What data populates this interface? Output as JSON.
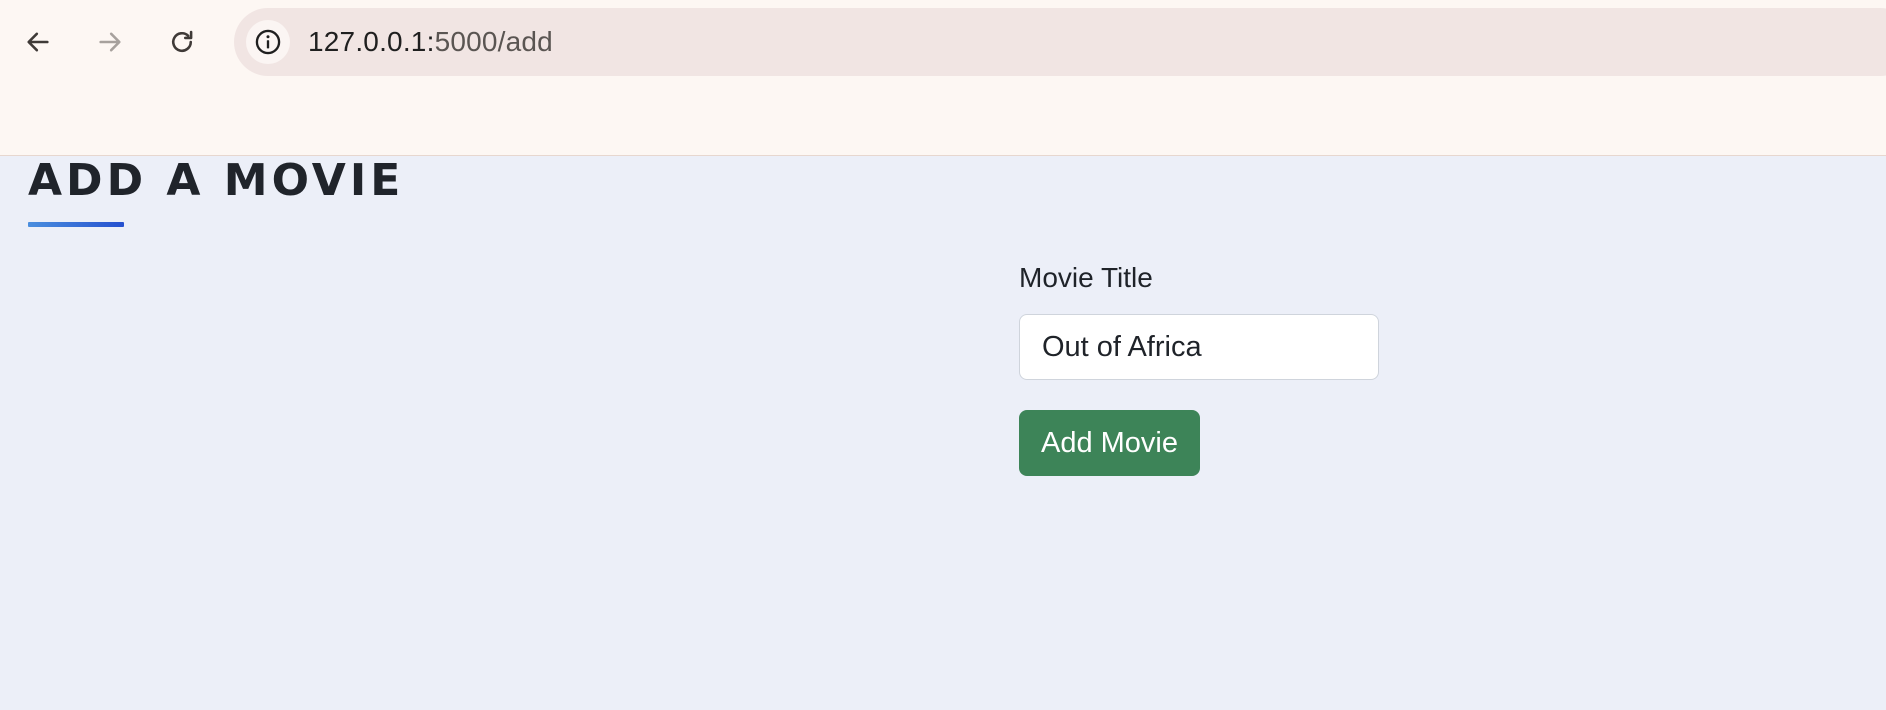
{
  "browser": {
    "url_host": "127.0.0.1:",
    "url_path": "5000/add",
    "icons": {
      "back": "arrow-left-icon",
      "forward": "arrow-right-icon",
      "reload": "reload-icon",
      "site_info": "info-icon"
    }
  },
  "page": {
    "heading": "ADD A MOVIE",
    "accent_gradient": [
      "#4a8ede",
      "#2550cf"
    ]
  },
  "form": {
    "title_label": "Movie Title",
    "title_value": "Out of Africa",
    "submit_label": "Add Movie",
    "submit_color": "#3d8458"
  }
}
